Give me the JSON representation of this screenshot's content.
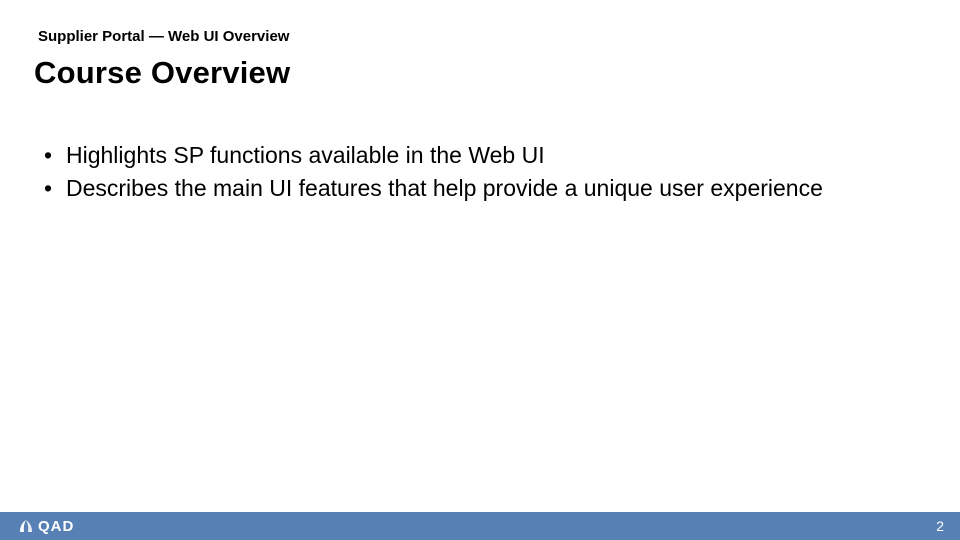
{
  "header": {
    "breadcrumb": "Supplier Portal — Web UI Overview",
    "title": "Course Overview"
  },
  "bullets": [
    "Highlights SP functions available in the Web UI",
    "Describes the main UI features that help provide a unique user experience"
  ],
  "footer": {
    "logo_text": "QAD",
    "page_number": "2",
    "bar_color": "#5781b5",
    "text_color": "#ffffff"
  }
}
